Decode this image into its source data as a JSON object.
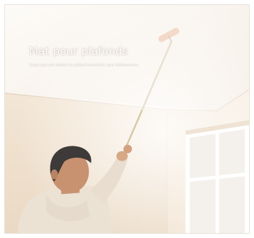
{
  "banner": {
    "headline": "Mat pour plafonds",
    "subline": "Conçu pour une peinture de plafond impeccable, sans éclaboussures."
  },
  "colors": {
    "wall": "#f2e6d8",
    "ceiling": "#fbf8f4",
    "window_frame": "#ffffff",
    "shirt": "#eee4d7"
  },
  "icons": []
}
